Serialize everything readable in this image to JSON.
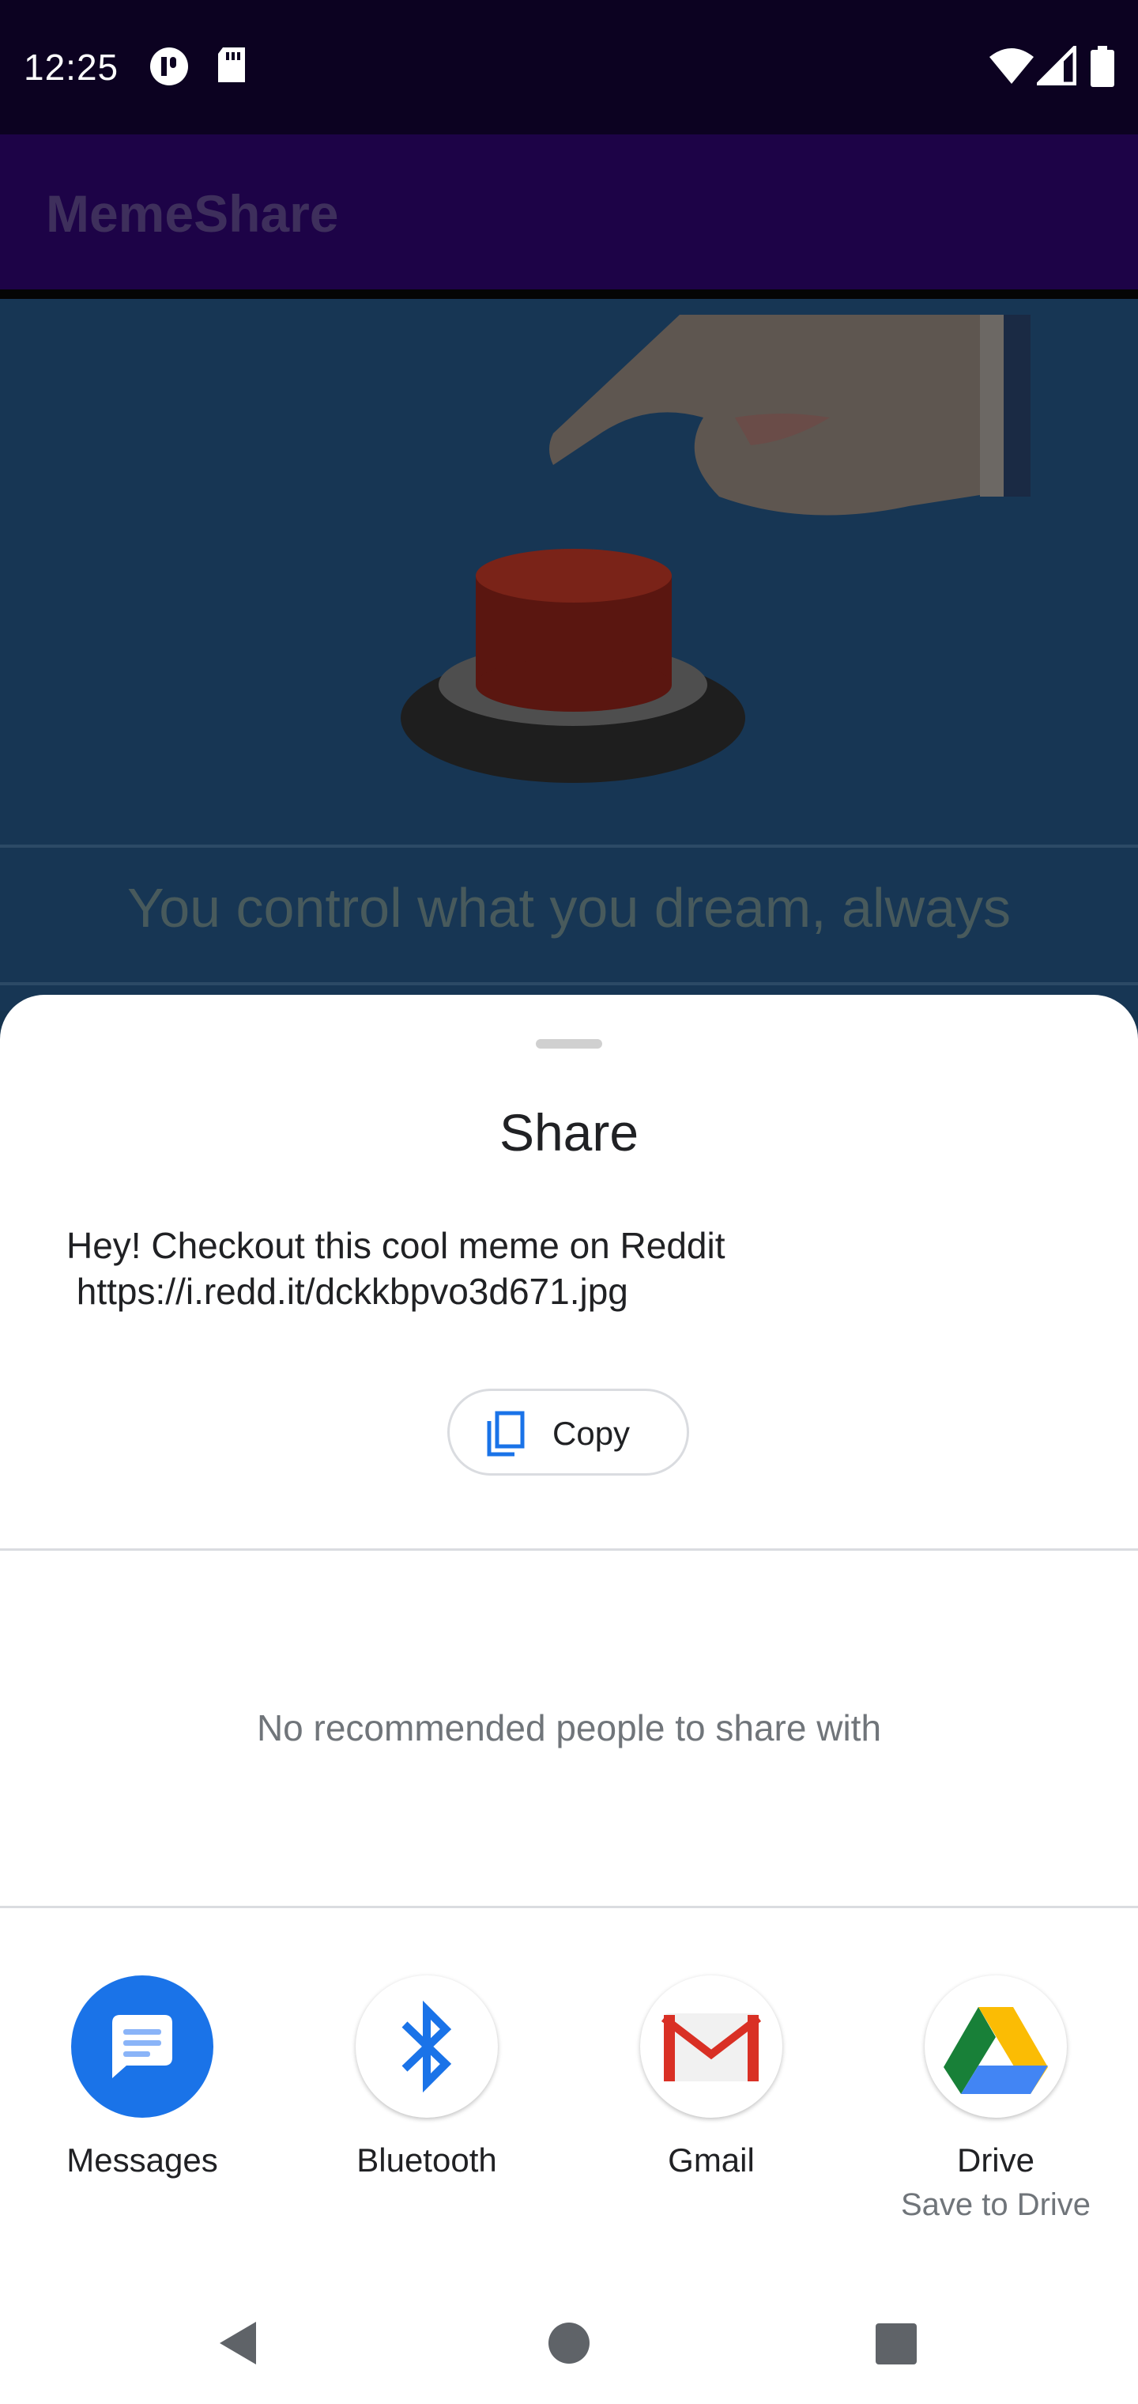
{
  "status_bar": {
    "time": "12:25",
    "left_icons": [
      "media-icon",
      "sd-card-icon"
    ],
    "right_icons": [
      "wifi-icon",
      "signal-icon",
      "battery-icon"
    ]
  },
  "app_bar": {
    "title": "MemeShare"
  },
  "meme": {
    "caption": "You control what you dream, always",
    "image_icon": "hand-pressing-button-illustration"
  },
  "share_sheet": {
    "title": "Share",
    "text": "Hey! Checkout this cool meme on Reddit\n https://i.redd.it/dckkbpvo3d671.jpg",
    "copy_label": "Copy",
    "no_people": "No recommended people to share with",
    "targets": [
      {
        "label": "Messages",
        "sublabel": "",
        "icon": "messages-icon"
      },
      {
        "label": "Bluetooth",
        "sublabel": "",
        "icon": "bluetooth-icon"
      },
      {
        "label": "Gmail",
        "sublabel": "",
        "icon": "gmail-icon"
      },
      {
        "label": "Drive",
        "sublabel": "Save to Drive",
        "icon": "drive-icon"
      }
    ]
  },
  "nav_bar": {
    "buttons": [
      "back-icon",
      "home-icon",
      "recents-icon"
    ]
  },
  "colors": {
    "status_bar": "#0c0221",
    "app_bar": "#1d0347",
    "scrim_content": "#173654",
    "accent_blue": "#1a73e8"
  }
}
